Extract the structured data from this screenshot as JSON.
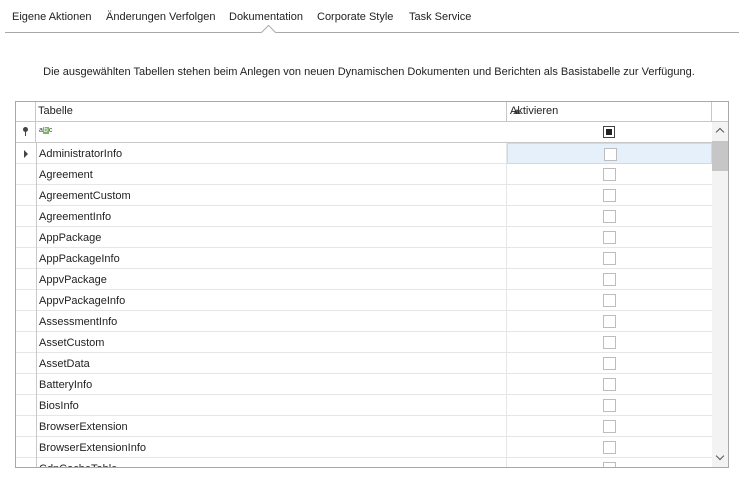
{
  "tabs": [
    {
      "label": "Eigene Aktionen"
    },
    {
      "label": "Änderungen Verfolgen"
    },
    {
      "label": "Dokumentation"
    },
    {
      "label": "Corporate Style"
    },
    {
      "label": "Task Service"
    }
  ],
  "active_tab": "Dokumentation",
  "description": "Die ausgewählten Tabellen stehen beim Anlegen von neuen Dynamischen Dokumenten und Berichten als Basistabelle zur Verfügung.",
  "grid": {
    "columns": {
      "tabelle": "Tabelle",
      "aktivieren": "Aktivieren"
    },
    "filter_row": {
      "text_filter_icon": "abc-filter-icon",
      "checkbox_state": "indeterminate"
    },
    "rows": [
      {
        "name": "AdministratorInfo",
        "checked": false
      },
      {
        "name": "Agreement",
        "checked": false
      },
      {
        "name": "AgreementCustom",
        "checked": false
      },
      {
        "name": "AgreementInfo",
        "checked": false
      },
      {
        "name": "AppPackage",
        "checked": false
      },
      {
        "name": "AppPackageInfo",
        "checked": false
      },
      {
        "name": "AppvPackage",
        "checked": false
      },
      {
        "name": "AppvPackageInfo",
        "checked": false
      },
      {
        "name": "AssessmentInfo",
        "checked": false
      },
      {
        "name": "AssetCustom",
        "checked": false
      },
      {
        "name": "AssetData",
        "checked": false
      },
      {
        "name": "BatteryInfo",
        "checked": false
      },
      {
        "name": "BiosInfo",
        "checked": false
      },
      {
        "name": "BrowserExtension",
        "checked": false
      },
      {
        "name": "BrowserExtensionInfo",
        "checked": false
      },
      {
        "name": "CdnCacheTable",
        "checked": false
      }
    ],
    "focused_row": "AdministratorInfo"
  }
}
